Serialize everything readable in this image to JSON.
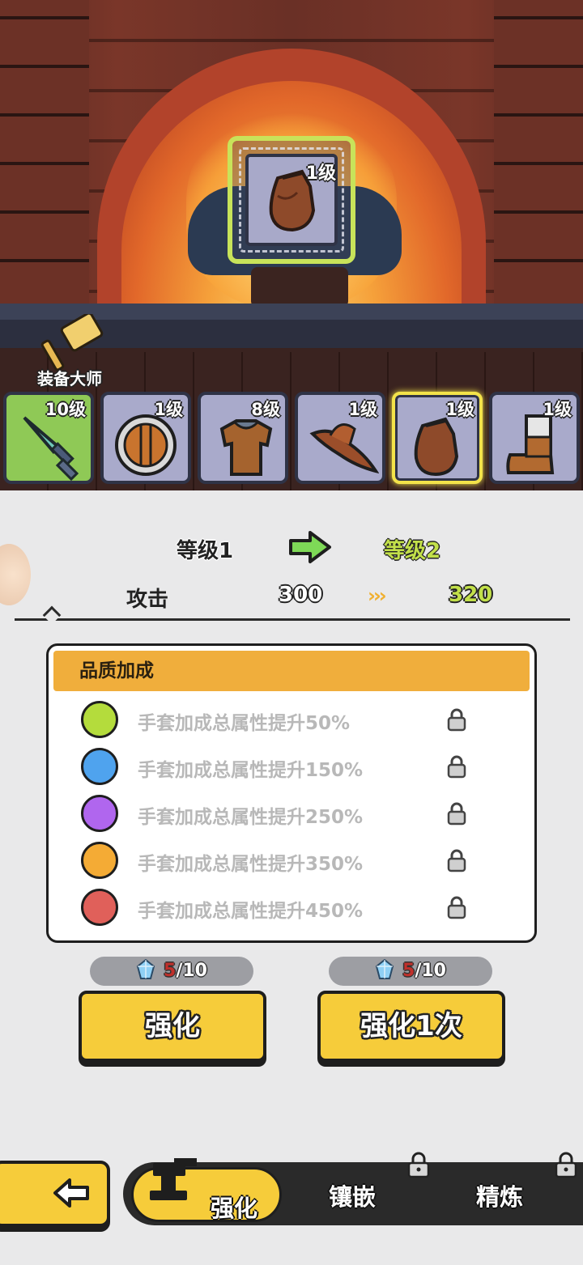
{
  "forge": {
    "selected_item": {
      "name": "gloves-icon",
      "level": "1级"
    },
    "master_label": "装备大师"
  },
  "equipment": [
    {
      "icon": "dagger-icon",
      "level": "10级",
      "bg": "#8fc956"
    },
    {
      "icon": "shield-icon",
      "level": "1级",
      "bg": "#a9aacb"
    },
    {
      "icon": "armor-icon",
      "level": "8级",
      "bg": "#a9aacb"
    },
    {
      "icon": "hat-icon",
      "level": "1级",
      "bg": "#a9aacb"
    },
    {
      "icon": "gloves-icon",
      "level": "1级",
      "bg": "#a9aacb",
      "selected": true
    },
    {
      "icon": "boots-icon",
      "level": "1级",
      "bg": "#a9aacb"
    }
  ],
  "upgrade": {
    "from_level": "等级1",
    "to_level": "等级2",
    "stat_name": "攻击",
    "stat_from": "300",
    "stat_to": "320",
    "chevrons": "›››"
  },
  "quality": {
    "title": "品质加成",
    "rows": [
      {
        "color": "#b4dc3c",
        "text": "手套加成总属性提升50%"
      },
      {
        "color": "#4fa3ee",
        "text": "手套加成总属性提升150%"
      },
      {
        "color": "#b066ee",
        "text": "手套加成总属性提升250%"
      },
      {
        "color": "#f4ab35",
        "text": "手套加成总属性提升350%"
      },
      {
        "color": "#e0605a",
        "text": "手套加成总属性提升450%"
      }
    ]
  },
  "costs": [
    {
      "current": "5",
      "total": "/10"
    },
    {
      "current": "5",
      "total": "/10"
    }
  ],
  "buttons": {
    "enhance": "强化",
    "enhance_once": "强化1次"
  },
  "nav": {
    "tabs": [
      "强化",
      "镶嵌",
      "精炼"
    ]
  },
  "colors": {
    "accent": "#f6cc3a",
    "quality_header": "#f0ae3c",
    "level_to": "#c2e04a",
    "selected_frame": "#c8e35a"
  }
}
